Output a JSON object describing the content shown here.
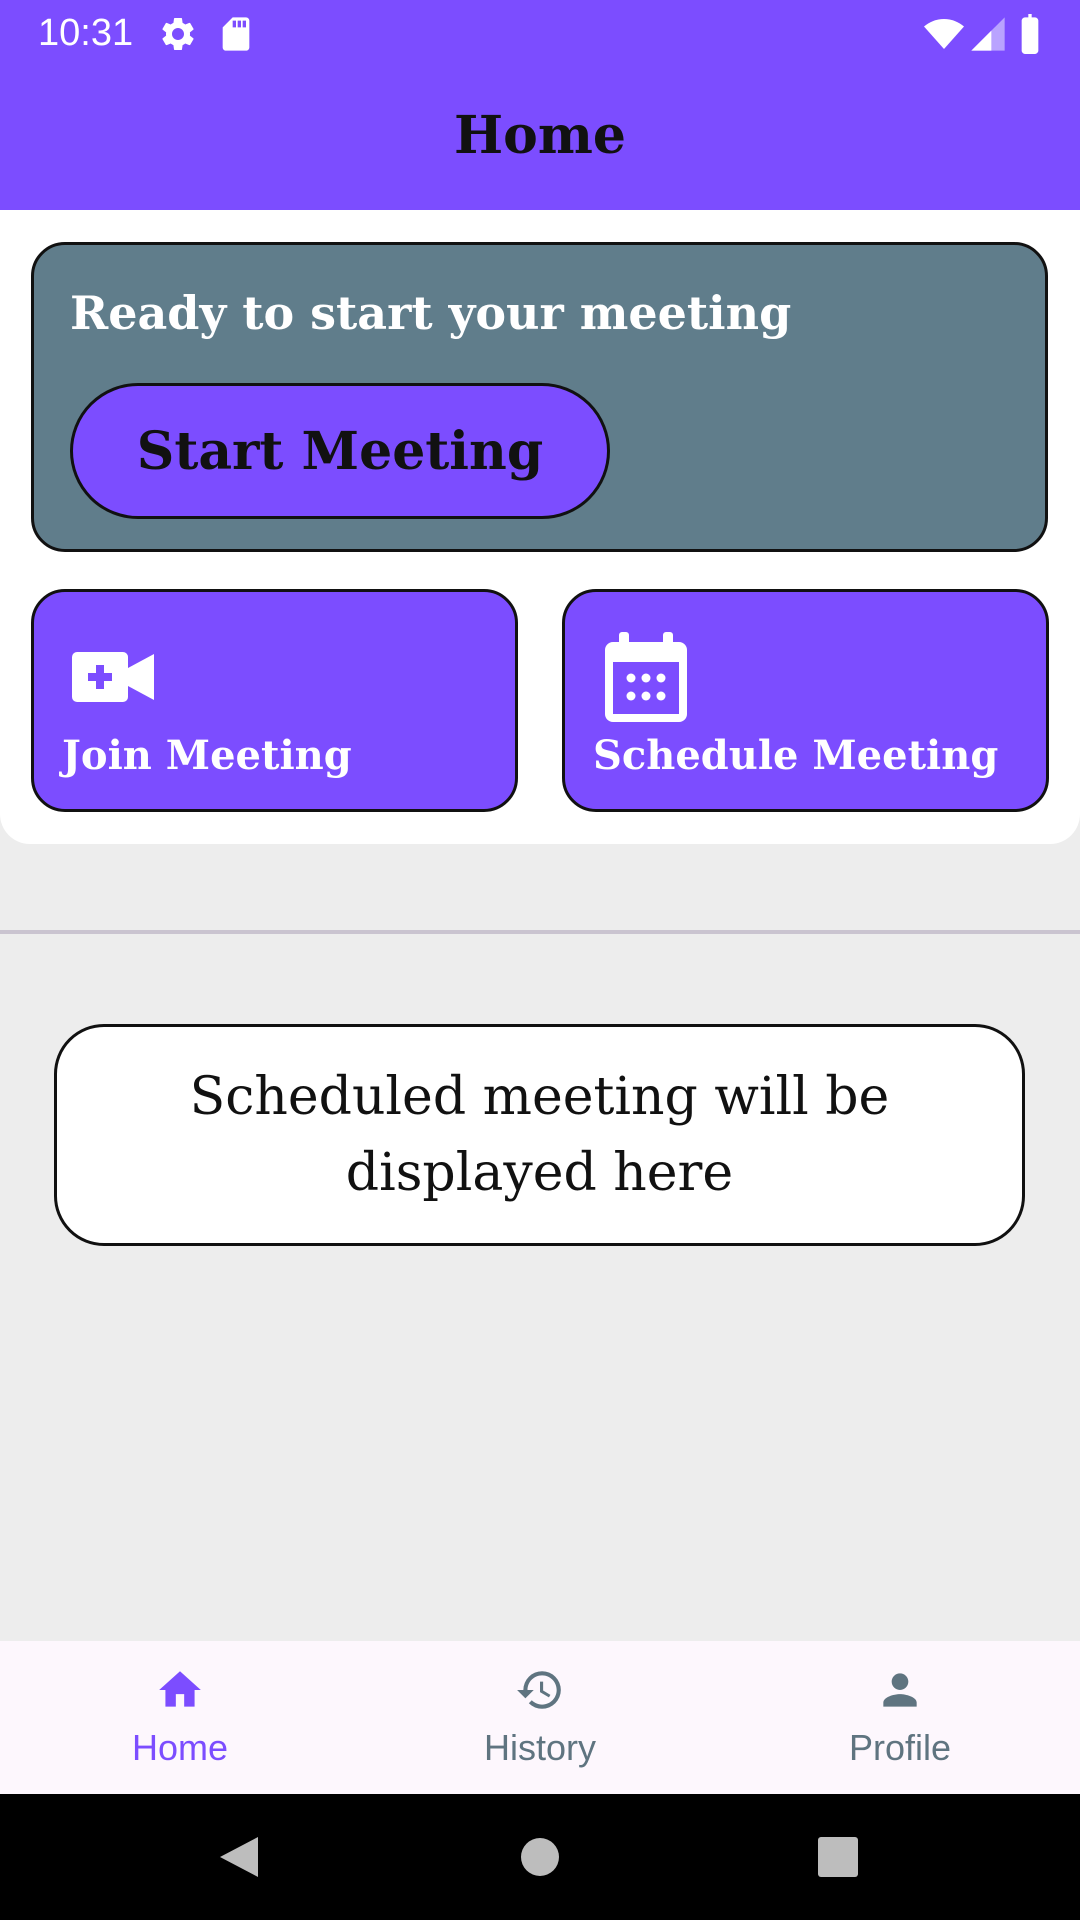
{
  "colors": {
    "primary": "#7c4dff",
    "card_grey": "#607d8b",
    "background": "#ededed",
    "nav_active": "#7c4dff",
    "nav_inactive": "#5f7480"
  },
  "status_bar": {
    "time": "10:31",
    "icons": [
      "settings-icon",
      "sd-card-icon",
      "wifi-icon",
      "cell-signal-icon",
      "battery-icon"
    ]
  },
  "app_bar": {
    "title": "Home"
  },
  "start_card": {
    "heading": "Ready to start your meeting",
    "button_label": "Start Meeting"
  },
  "actions": [
    {
      "label": "Join Meeting",
      "icon": "video-add-icon"
    },
    {
      "label": "Schedule Meeting",
      "icon": "calendar-icon"
    }
  ],
  "scheduled": {
    "placeholder": "Scheduled meeting will be displayed here"
  },
  "bottom_nav": {
    "items": [
      {
        "label": "Home",
        "icon": "home-icon",
        "active": true
      },
      {
        "label": "History",
        "icon": "history-icon",
        "active": false
      },
      {
        "label": "Profile",
        "icon": "person-icon",
        "active": false
      }
    ]
  },
  "system_nav": {
    "buttons": [
      "back-icon",
      "home-circle-icon",
      "recents-icon"
    ]
  }
}
